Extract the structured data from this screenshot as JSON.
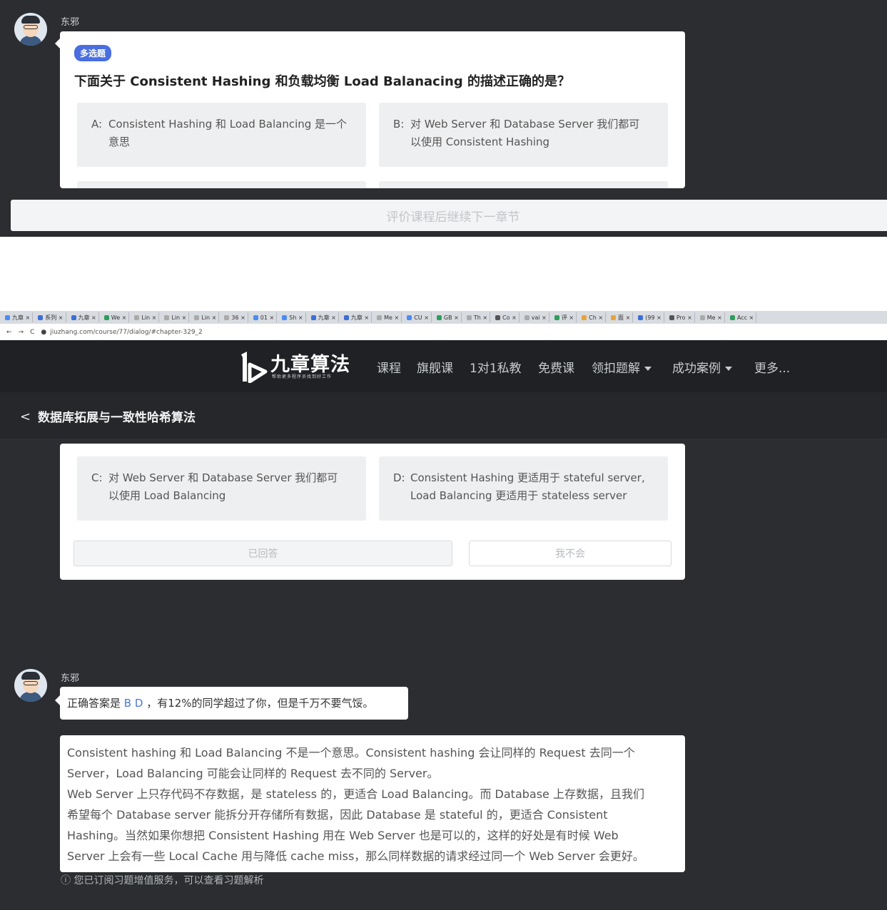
{
  "top": {
    "sender": "东邪",
    "tag": "多选题",
    "question": "下面关于 Consistent Hashing 和负载均衡 Load Balanacing 的描述正确的是？",
    "options": [
      {
        "key": "A:",
        "line1": "Consistent Hashing 和 Load Balancing 是一个",
        "line2": "意思"
      },
      {
        "key": "B:",
        "line1": "对 Web Server 和 Database Server 我们都可",
        "line2": "以使用 Consistent Hashing"
      }
    ],
    "cta": "评价课程后继续下一章节"
  },
  "browser": {
    "tabs": [
      "九章 ×",
      "系列 ×",
      "九章 ×",
      "We ×",
      "Lin ×",
      "Lin ×",
      "Lin ×",
      "36 ×",
      "01 ×",
      "Sh ×",
      "九章 ×",
      "九章 ×",
      "Me ×",
      "CU ×",
      "GB ×",
      "Th ×",
      "Co ×",
      "vai ×",
      "评 ×",
      "Ch ×",
      "面 ×",
      "(99 ×",
      "Pro ×",
      "Me ×",
      "Acc ×"
    ],
    "url": "jiuzhang.com/course/77/dialog/#chapter-329_2",
    "nav_back": "←",
    "nav_forward": "→",
    "nav_reload": "C"
  },
  "nav": {
    "logo": "九章算法",
    "logo_sub": "帮助更多程序员找到好工作",
    "items": [
      "课程",
      "旗舰课",
      "1对1私教",
      "免费课",
      "领扣题解",
      "成功案例",
      "更多..."
    ]
  },
  "subheader": {
    "back": "<",
    "title": "数据库拓展与一致性哈希算法"
  },
  "bottom": {
    "options": [
      {
        "key": "C:",
        "line1": "对 Web Server 和 Database Server 我们都可",
        "line2": "以使用 Load Balancing"
      },
      {
        "key": "D:",
        "line1": "Consistent Hashing 更适用于 stateful server,",
        "line2": "Load Balancing 更适用于 stateless server"
      }
    ],
    "answered_button": "已回答",
    "dont_know_button": "我不会",
    "sender": "东邪",
    "answer_prefix": "正确答案是",
    "answer_letters": "B D",
    "answer_suffix": "，有12%的同学超过了你，但是千万不要气馁。",
    "explanation": [
      "Consistent hashing 和 Load Balancing 不是一个意思。Consistent hashing 会让同样的 Request 去同一个",
      "Server，Load Balancing 可能会让同样的 Request 去不同的 Server。",
      "Web Server 上只存代码不存数据，是 stateless 的，更适合 Load Balancing。而 Database 上存数据，且我们",
      "希望每个 Database server 能拆分开存储所有数据，因此 Database 是 stateful 的，更适合 Consistent",
      "Hashing。当然如果你想把 Consistent Hashing 用在 Web Server 也是可以的，这样的好处是有时候 Web",
      "Server 上会有一些 Local Cache 用与降低 cache miss，那么同样数据的请求经过同一个 Web Server 会更好。"
    ],
    "notice": "ⓘ 您已订阅习题增值服务，可以查看习题解析"
  }
}
